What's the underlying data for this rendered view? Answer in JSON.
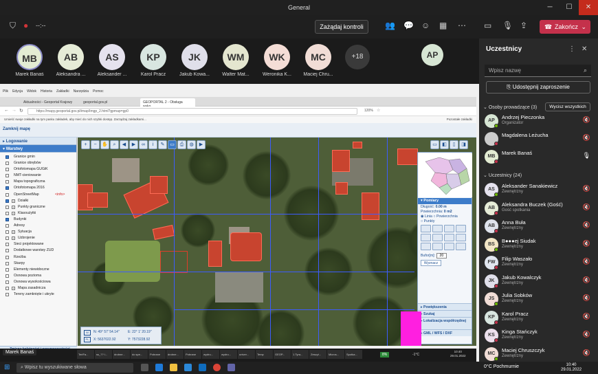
{
  "window": {
    "title": "General"
  },
  "toolbar": {
    "timer": "--:--",
    "request_control": "Zażądaj kontroli",
    "end_call": "Zakończ"
  },
  "strip": {
    "participants": [
      {
        "initials": "MB",
        "name": "Marek Banaś",
        "color": "#e3ecd3"
      },
      {
        "initials": "AB",
        "name": "Aleksandra ...",
        "color": "#e6ecd7"
      },
      {
        "initials": "AS",
        "name": "Aleksander ...",
        "color": "#e5e2ee"
      },
      {
        "initials": "KP",
        "name": "Karol Pracz",
        "color": "#d8e6e0"
      },
      {
        "initials": "JK",
        "name": "Jakub Kowa...",
        "color": "#e0dfea"
      },
      {
        "initials": "WM",
        "name": "Walter Mat...",
        "color": "#e4e6cf"
      },
      {
        "initials": "WK",
        "name": "Weronika K...",
        "color": "#f4ddd6"
      },
      {
        "initials": "MC",
        "name": "Maciej Chru...",
        "color": "#f1ddd6"
      }
    ],
    "more": "+18",
    "extra": {
      "initials": "AP",
      "color": "#d7e6d4"
    }
  },
  "browser": {
    "menu": [
      "Plik",
      "Edycja",
      "Widok",
      "Historia",
      "Zakładki",
      "Narzędzia",
      "Pomoc"
    ],
    "tabs": [
      "Aktualności - Geoportal Krajowy",
      "geoportal.gov.pl",
      "GEOPORTAL 2 - Obsługa wyko..."
    ],
    "url": "https://mapy.geoportal.gov.pl/imap/Imgp_2.html?gpmap=gp0",
    "zoom": "120%",
    "infobar": "Umieść swoje zakładki na tym pasku zakładek, aby mieć do nich szybki dostęp. Zarządzaj zakładkami...",
    "bookmark": "Pozostałe zakładki"
  },
  "geoportal": {
    "close_map": "Zamknij mapę",
    "sections": {
      "login": "Logowanie",
      "layers": "Warstwy"
    },
    "layers": [
      {
        "label": "Granice gmin",
        "on": true,
        "plus": false
      },
      {
        "label": "Granice obrębów",
        "on": false,
        "plus": false
      },
      {
        "label": "Ortofotomapa GUGiK",
        "on": false,
        "plus": false
      },
      {
        "label": "NMT-cieniowanie",
        "on": false,
        "plus": false
      },
      {
        "label": "Mapa topograficzna",
        "on": false,
        "plus": false
      },
      {
        "label": "Ortofotomapa 2016",
        "on": true,
        "plus": false
      },
      {
        "label": "OpenStreetMap",
        "on": false,
        "plus": false
      },
      {
        "label": "Działki",
        "on": true,
        "plus": true
      },
      {
        "label": "Punkty graniczne",
        "on": false,
        "plus": true
      },
      {
        "label": "Klasoużytki",
        "on": false,
        "plus": true
      },
      {
        "label": "Budynki",
        "on": true,
        "plus": false
      },
      {
        "label": "Adresy",
        "on": false,
        "plus": false
      },
      {
        "label": "Sytuacja",
        "on": false,
        "plus": true
      },
      {
        "label": "Uzbrojenie",
        "on": false,
        "plus": true
      },
      {
        "label": "Sieci projektowane",
        "on": false,
        "plus": false
      },
      {
        "label": "Dodatkowe warstwy ZUD",
        "on": false,
        "plus": false
      },
      {
        "label": "Rzeźba",
        "on": false,
        "plus": false
      },
      {
        "label": "Skarpy",
        "on": false,
        "plus": false
      },
      {
        "label": "Elementy niewidoczne",
        "on": false,
        "plus": false
      },
      {
        "label": "Osnowa pozioma",
        "on": false,
        "plus": false
      },
      {
        "label": "Osnowa wysokościowa",
        "on": false,
        "plus": false
      },
      {
        "label": "Mapa zasadnicza",
        "on": false,
        "plus": true
      },
      {
        "label": "Tereny zamknięte i ukryte",
        "on": false,
        "plus": false
      }
    ],
    "osm_note": "<info>",
    "bottom_section": "Zmiana kolejności i przezroczystości",
    "pomiary": {
      "title": "Pomiary",
      "dlugosc_label": "Długość:",
      "dlugosc_value": "0.00 m",
      "powierzchnia_label": "Powierzchnia:",
      "powierzchnia_value": "0 m2",
      "opt_linia": "Linia",
      "opt_powierzchnia": "Powierzchnia",
      "opt_punkty": "Punkty",
      "bufor_label": "Bufor[m]:",
      "bufor_value": "20",
      "wyznacz": "Wyznacz"
    },
    "panel_sections": [
      "Powiększenia",
      "Szukaj",
      "Lokalizacja współrzędnej",
      "GML / WFS / DXF"
    ],
    "coords": {
      "n": "N: 49° 57' 54.14''",
      "e": "E: 22° 1' 20.19''",
      "x": "X: 5637022.92",
      "y": "Y: 7573228.92"
    }
  },
  "inner_taskbar": {
    "items": [
      "TeriFa...",
      "ss_?? l...",
      "drobne...",
      "do spe...",
      "Pobrane",
      "drobne...",
      "Pobrane",
      "wydru...",
      "wydru...",
      "univer...",
      "Temp",
      "GEOP...",
      "1.Tyra...",
      "Zeszyt...",
      "Micros...",
      "Spotka..."
    ],
    "badge": "8%",
    "weather": "-1°C",
    "time": "10:40",
    "date": "29.01.2022"
  },
  "share_label": "Marek Banaś",
  "panel": {
    "title": "Uczestnicy",
    "search_placeholder": "Wpisz nazwę",
    "invite": "Udostępnij zaproszenie",
    "presenters_label": "Osoby prowadzące (3)",
    "mute_all": "Wycisz wszystkich",
    "presenters": [
      {
        "initials": "AP",
        "name": "Andrzej Pieczonka",
        "role": "Organizator",
        "color": "#d7e6d4"
      },
      {
        "initials": "",
        "name": "Magdalena Leżucha",
        "role": "",
        "color": "#cccccc"
      },
      {
        "initials": "MB",
        "name": "Marek Banaś",
        "role": "",
        "color": "#e3ecd3"
      }
    ],
    "attendees_label": "Uczestnicy (24)",
    "attendees": [
      {
        "initials": "AS",
        "name": "Aleksander Sanakiewicz",
        "role": "Zewnętrzny",
        "color": "#e5e2ee"
      },
      {
        "initials": "AB",
        "name": "Aleksandra Buczek (Gość)",
        "role": "Gość spotkania",
        "color": "#e6ecd7"
      },
      {
        "initials": "AB",
        "name": "Anna Buła",
        "role": "Zewnętrzny",
        "color": "#dfe3ec"
      },
      {
        "initials": "BS",
        "name": "B●●●ej Siudak",
        "role": "Zewnętrzny",
        "color": "#f2e6c6"
      },
      {
        "initials": "FW",
        "name": "Filip Waszało",
        "role": "Zewnętrzny",
        "color": "#e1e6ef"
      },
      {
        "initials": "JK",
        "name": "Jakub Kowalczyk",
        "role": "Zewnętrzny",
        "color": "#e0dfea"
      },
      {
        "initials": "JS",
        "name": "Julia Sobków",
        "role": "Zewnętrzny",
        "color": "#f1ddd6"
      },
      {
        "initials": "KP",
        "name": "Karol Pracz",
        "role": "Zewnętrzny",
        "color": "#d8e6e0"
      },
      {
        "initials": "KS",
        "name": "Kinga Stańczyk",
        "role": "Zewnętrzny",
        "color": "#ece0ec"
      },
      {
        "initials": "MC",
        "name": "Maciej Chruszczyk",
        "role": "Zewnętrzny",
        "color": "#f1ddd6"
      }
    ]
  },
  "taskbar": {
    "search": "Wpisz tu wyszukiwane słowa",
    "weather": "0°C Pochmurnie",
    "time": "10:40",
    "date": "29.01.2022"
  },
  "colors": {
    "end_call": "#c4314b",
    "accent": "#3d7cc9",
    "highlight": "#ff1fe0"
  }
}
